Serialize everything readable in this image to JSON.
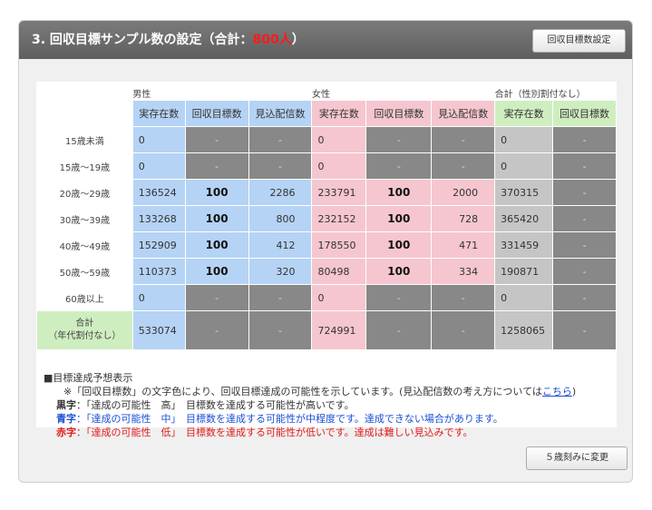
{
  "header": {
    "title_prefix": "3. 回収目標サンプル数の設定（合計：",
    "title_value": "800人",
    "title_suffix": "）",
    "button_label": "回収目標数設定"
  },
  "table": {
    "groups": [
      "男性",
      "女性",
      "合計（性別割付なし）"
    ],
    "sub_headers": [
      "実存在数",
      "回収目標数",
      "見込配信数",
      "実存在数",
      "回収目標数",
      "見込配信数",
      "実存在数",
      "回収目標数"
    ],
    "rows": [
      {
        "label": "15歳未満",
        "cells": [
          "0",
          "-",
          "-",
          "0",
          "-",
          "-",
          "0",
          "-"
        ]
      },
      {
        "label": "15歳～19歳",
        "cells": [
          "0",
          "-",
          "-",
          "0",
          "-",
          "-",
          "0",
          "-"
        ]
      },
      {
        "label": "20歳～29歳",
        "cells": [
          "136524",
          "100",
          "2286",
          "233791",
          "100",
          "2000",
          "370315",
          "-"
        ]
      },
      {
        "label": "30歳～39歳",
        "cells": [
          "133268",
          "100",
          "800",
          "232152",
          "100",
          "728",
          "365420",
          "-"
        ]
      },
      {
        "label": "40歳～49歳",
        "cells": [
          "152909",
          "100",
          "412",
          "178550",
          "100",
          "471",
          "331459",
          "-"
        ]
      },
      {
        "label": "50歳～59歳",
        "cells": [
          "110373",
          "100",
          "320",
          "80498",
          "100",
          "334",
          "190871",
          "-"
        ]
      },
      {
        "label": "60歳以上",
        "cells": [
          "0",
          "-",
          "-",
          "0",
          "-",
          "-",
          "0",
          "-"
        ]
      }
    ],
    "total": {
      "label_line1": "合計",
      "label_line2": "（年代割付なし）",
      "cells": [
        "533074",
        "-",
        "-",
        "724991",
        "-",
        "-",
        "1258065",
        "-"
      ]
    }
  },
  "notes": {
    "heading": "■目標達成予想表示",
    "explain_before": "※「回収目標数」の文字色により、回収目標達成の可能性を示しています。(見込配信数の考え方については",
    "explain_link": "こちら",
    "explain_after": ")",
    "black_key": "黒字",
    "black_text": "：「達成の可能性　高」　目標数を達成する可能性が高いです。",
    "blue_key": "青字",
    "blue_text": "：「達成の可能性　中」　目標数を達成する可能性が中程度です。達成できない場合があります。",
    "red_key": "赤字",
    "red_text": "：「達成の可能性　低」　目標数を達成する可能性が低いです。達成は難しい見込みです。"
  },
  "footer": {
    "button_label": "５歳刻みに変更"
  }
}
